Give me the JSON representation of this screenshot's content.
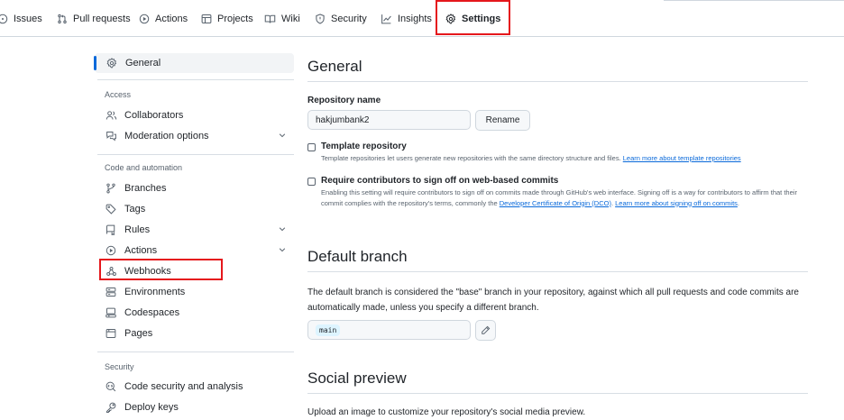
{
  "nav": {
    "tabs": [
      {
        "label": "Issues",
        "icon": "issue-opened-icon"
      },
      {
        "label": "Pull requests",
        "icon": "git-pull-request-icon"
      },
      {
        "label": "Actions",
        "icon": "play-icon"
      },
      {
        "label": "Projects",
        "icon": "table-icon"
      },
      {
        "label": "Wiki",
        "icon": "book-icon"
      },
      {
        "label": "Security",
        "icon": "shield-icon"
      },
      {
        "label": "Insights",
        "icon": "graph-icon"
      },
      {
        "label": "Settings",
        "icon": "gear-icon",
        "selected": true
      }
    ]
  },
  "sidebar": {
    "general": "General",
    "access_heading": "Access",
    "collaborators": "Collaborators",
    "moderation": "Moderation options",
    "code_heading": "Code and automation",
    "branches": "Branches",
    "tags": "Tags",
    "rules": "Rules",
    "actions": "Actions",
    "webhooks": "Webhooks",
    "environments": "Environments",
    "codespaces": "Codespaces",
    "pages": "Pages",
    "security_heading": "Security",
    "code_security": "Code security and analysis",
    "deploy_keys": "Deploy keys"
  },
  "main": {
    "general_title": "General",
    "repo_name_label": "Repository name",
    "repo_name_value": "hakjumbank2",
    "rename_button": "Rename",
    "template": {
      "title": "Template repository",
      "desc": "Template repositories let users generate new repositories with the same directory structure and files. ",
      "link": "Learn more about template repositories"
    },
    "signoff": {
      "title": "Require contributors to sign off on web-based commits",
      "desc_1": "Enabling this setting will require contributors to sign off on commits made through GitHub's web interface. Signing off is a way for contributors to affirm that their commit complies with the repository's terms, commonly the ",
      "link_dco": "Developer Certificate of Origin (DCO)",
      "desc_2": ". ",
      "link_learn": "Learn more about signing off on commits",
      "desc_3": "."
    },
    "default_branch": {
      "title": "Default branch",
      "desc": "The default branch is considered the \"base\" branch in your repository, against which all pull requests and code commits are automatically made, unless you specify a different branch.",
      "branch": "main"
    },
    "social_preview": {
      "title": "Social preview",
      "desc": "Upload an image to customize your repository's social media preview."
    }
  },
  "colors": {
    "accent": "#0969da",
    "selected_underline": "#fd8c73",
    "highlight_box": "#e5171c"
  }
}
